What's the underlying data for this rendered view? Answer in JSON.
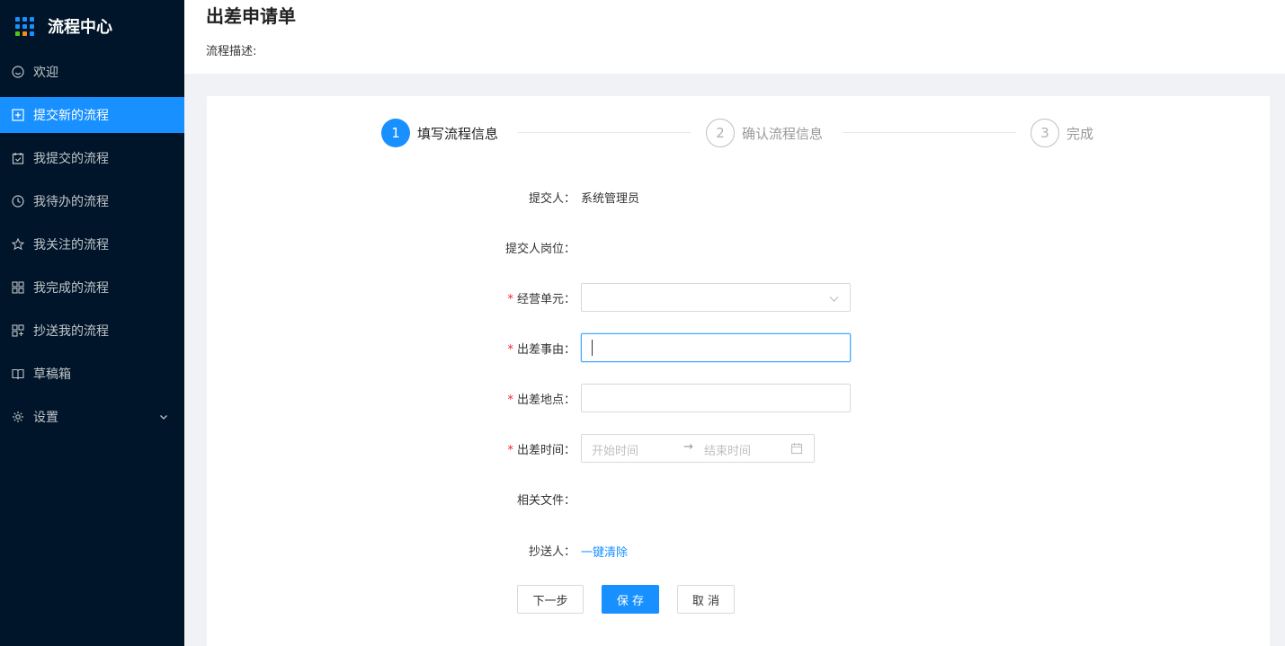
{
  "app": {
    "title": "流程中心"
  },
  "sidebar": {
    "items": [
      {
        "label": "欢迎",
        "icon": "smile-icon"
      },
      {
        "label": "提交新的流程",
        "icon": "plus-square-icon",
        "active": true
      },
      {
        "label": "我提交的流程",
        "icon": "calendar-check-icon"
      },
      {
        "label": "我待办的流程",
        "icon": "clock-icon"
      },
      {
        "label": "我关注的流程",
        "icon": "star-icon"
      },
      {
        "label": "我完成的流程",
        "icon": "appstore-icon"
      },
      {
        "label": "抄送我的流程",
        "icon": "copy-icon"
      },
      {
        "label": "草稿箱",
        "icon": "book-icon"
      },
      {
        "label": "设置",
        "icon": "gear-icon"
      }
    ]
  },
  "header": {
    "title": "出差申请单",
    "description": "流程描述:"
  },
  "steps": [
    {
      "number": "1",
      "label": "填写流程信息",
      "status": "active"
    },
    {
      "number": "2",
      "label": "确认流程信息",
      "status": "wait"
    },
    {
      "number": "3",
      "label": "完成",
      "status": "wait"
    }
  ],
  "form": {
    "submitter_label": "提交人：",
    "submitter_value": "系统管理员",
    "position_label": "提交人岗位：",
    "unit_label": "经营单元：",
    "reason_label": "出差事由：",
    "location_label": "出差地点：",
    "time_label": "出差时间：",
    "start_placeholder": "开始时间",
    "range_separator": "→",
    "end_placeholder": "结束时间",
    "files_label": "相关文件：",
    "cc_label": "抄送人：",
    "clear_link": "一键清除",
    "required_mark": "*"
  },
  "buttons": {
    "next": "下一步",
    "save": "保 存",
    "cancel": "取 消"
  },
  "colors": {
    "primary": "#1890ff",
    "sidebar_bg": "#001529",
    "required": "#f5222d"
  }
}
